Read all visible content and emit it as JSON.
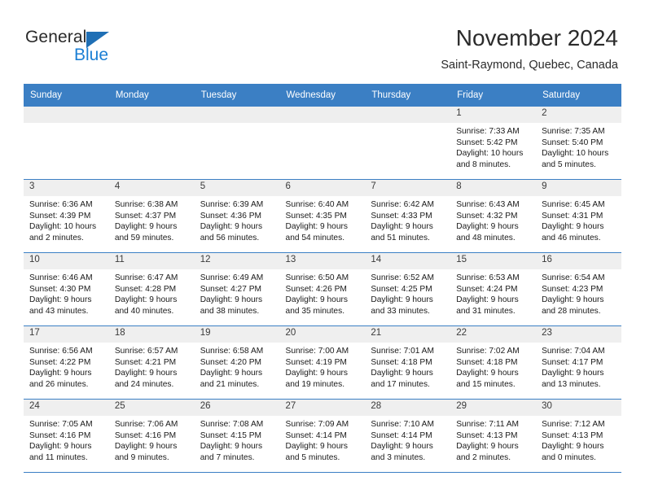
{
  "brand": {
    "name_part1": "General",
    "name_part2": "Blue",
    "triangle_color": "#1f6fb5",
    "blue_color": "#1b7fd4"
  },
  "header": {
    "title": "November 2024",
    "location": "Saint-Raymond, Quebec, Canada"
  },
  "theme": {
    "header_blue": "#3b7fc4",
    "daynum_band": "#efefef",
    "empty_band": "#eeeeee"
  },
  "weekdays": [
    "Sunday",
    "Monday",
    "Tuesday",
    "Wednesday",
    "Thursday",
    "Friday",
    "Saturday"
  ],
  "weeks": [
    [
      {
        "empty": true
      },
      {
        "empty": true
      },
      {
        "empty": true
      },
      {
        "empty": true
      },
      {
        "empty": true
      },
      {
        "day": "1",
        "sunrise": "Sunrise: 7:33 AM",
        "sunset": "Sunset: 5:42 PM",
        "daylight1": "Daylight: 10 hours",
        "daylight2": "and 8 minutes."
      },
      {
        "day": "2",
        "sunrise": "Sunrise: 7:35 AM",
        "sunset": "Sunset: 5:40 PM",
        "daylight1": "Daylight: 10 hours",
        "daylight2": "and 5 minutes."
      }
    ],
    [
      {
        "day": "3",
        "sunrise": "Sunrise: 6:36 AM",
        "sunset": "Sunset: 4:39 PM",
        "daylight1": "Daylight: 10 hours",
        "daylight2": "and 2 minutes."
      },
      {
        "day": "4",
        "sunrise": "Sunrise: 6:38 AM",
        "sunset": "Sunset: 4:37 PM",
        "daylight1": "Daylight: 9 hours",
        "daylight2": "and 59 minutes."
      },
      {
        "day": "5",
        "sunrise": "Sunrise: 6:39 AM",
        "sunset": "Sunset: 4:36 PM",
        "daylight1": "Daylight: 9 hours",
        "daylight2": "and 56 minutes."
      },
      {
        "day": "6",
        "sunrise": "Sunrise: 6:40 AM",
        "sunset": "Sunset: 4:35 PM",
        "daylight1": "Daylight: 9 hours",
        "daylight2": "and 54 minutes."
      },
      {
        "day": "7",
        "sunrise": "Sunrise: 6:42 AM",
        "sunset": "Sunset: 4:33 PM",
        "daylight1": "Daylight: 9 hours",
        "daylight2": "and 51 minutes."
      },
      {
        "day": "8",
        "sunrise": "Sunrise: 6:43 AM",
        "sunset": "Sunset: 4:32 PM",
        "daylight1": "Daylight: 9 hours",
        "daylight2": "and 48 minutes."
      },
      {
        "day": "9",
        "sunrise": "Sunrise: 6:45 AM",
        "sunset": "Sunset: 4:31 PM",
        "daylight1": "Daylight: 9 hours",
        "daylight2": "and 46 minutes."
      }
    ],
    [
      {
        "day": "10",
        "sunrise": "Sunrise: 6:46 AM",
        "sunset": "Sunset: 4:30 PM",
        "daylight1": "Daylight: 9 hours",
        "daylight2": "and 43 minutes."
      },
      {
        "day": "11",
        "sunrise": "Sunrise: 6:47 AM",
        "sunset": "Sunset: 4:28 PM",
        "daylight1": "Daylight: 9 hours",
        "daylight2": "and 40 minutes."
      },
      {
        "day": "12",
        "sunrise": "Sunrise: 6:49 AM",
        "sunset": "Sunset: 4:27 PM",
        "daylight1": "Daylight: 9 hours",
        "daylight2": "and 38 minutes."
      },
      {
        "day": "13",
        "sunrise": "Sunrise: 6:50 AM",
        "sunset": "Sunset: 4:26 PM",
        "daylight1": "Daylight: 9 hours",
        "daylight2": "and 35 minutes."
      },
      {
        "day": "14",
        "sunrise": "Sunrise: 6:52 AM",
        "sunset": "Sunset: 4:25 PM",
        "daylight1": "Daylight: 9 hours",
        "daylight2": "and 33 minutes."
      },
      {
        "day": "15",
        "sunrise": "Sunrise: 6:53 AM",
        "sunset": "Sunset: 4:24 PM",
        "daylight1": "Daylight: 9 hours",
        "daylight2": "and 31 minutes."
      },
      {
        "day": "16",
        "sunrise": "Sunrise: 6:54 AM",
        "sunset": "Sunset: 4:23 PM",
        "daylight1": "Daylight: 9 hours",
        "daylight2": "and 28 minutes."
      }
    ],
    [
      {
        "day": "17",
        "sunrise": "Sunrise: 6:56 AM",
        "sunset": "Sunset: 4:22 PM",
        "daylight1": "Daylight: 9 hours",
        "daylight2": "and 26 minutes."
      },
      {
        "day": "18",
        "sunrise": "Sunrise: 6:57 AM",
        "sunset": "Sunset: 4:21 PM",
        "daylight1": "Daylight: 9 hours",
        "daylight2": "and 24 minutes."
      },
      {
        "day": "19",
        "sunrise": "Sunrise: 6:58 AM",
        "sunset": "Sunset: 4:20 PM",
        "daylight1": "Daylight: 9 hours",
        "daylight2": "and 21 minutes."
      },
      {
        "day": "20",
        "sunrise": "Sunrise: 7:00 AM",
        "sunset": "Sunset: 4:19 PM",
        "daylight1": "Daylight: 9 hours",
        "daylight2": "and 19 minutes."
      },
      {
        "day": "21",
        "sunrise": "Sunrise: 7:01 AM",
        "sunset": "Sunset: 4:18 PM",
        "daylight1": "Daylight: 9 hours",
        "daylight2": "and 17 minutes."
      },
      {
        "day": "22",
        "sunrise": "Sunrise: 7:02 AM",
        "sunset": "Sunset: 4:18 PM",
        "daylight1": "Daylight: 9 hours",
        "daylight2": "and 15 minutes."
      },
      {
        "day": "23",
        "sunrise": "Sunrise: 7:04 AM",
        "sunset": "Sunset: 4:17 PM",
        "daylight1": "Daylight: 9 hours",
        "daylight2": "and 13 minutes."
      }
    ],
    [
      {
        "day": "24",
        "sunrise": "Sunrise: 7:05 AM",
        "sunset": "Sunset: 4:16 PM",
        "daylight1": "Daylight: 9 hours",
        "daylight2": "and 11 minutes."
      },
      {
        "day": "25",
        "sunrise": "Sunrise: 7:06 AM",
        "sunset": "Sunset: 4:16 PM",
        "daylight1": "Daylight: 9 hours",
        "daylight2": "and 9 minutes."
      },
      {
        "day": "26",
        "sunrise": "Sunrise: 7:08 AM",
        "sunset": "Sunset: 4:15 PM",
        "daylight1": "Daylight: 9 hours",
        "daylight2": "and 7 minutes."
      },
      {
        "day": "27",
        "sunrise": "Sunrise: 7:09 AM",
        "sunset": "Sunset: 4:14 PM",
        "daylight1": "Daylight: 9 hours",
        "daylight2": "and 5 minutes."
      },
      {
        "day": "28",
        "sunrise": "Sunrise: 7:10 AM",
        "sunset": "Sunset: 4:14 PM",
        "daylight1": "Daylight: 9 hours",
        "daylight2": "and 3 minutes."
      },
      {
        "day": "29",
        "sunrise": "Sunrise: 7:11 AM",
        "sunset": "Sunset: 4:13 PM",
        "daylight1": "Daylight: 9 hours",
        "daylight2": "and 2 minutes."
      },
      {
        "day": "30",
        "sunrise": "Sunrise: 7:12 AM",
        "sunset": "Sunset: 4:13 PM",
        "daylight1": "Daylight: 9 hours",
        "daylight2": "and 0 minutes."
      }
    ]
  ]
}
